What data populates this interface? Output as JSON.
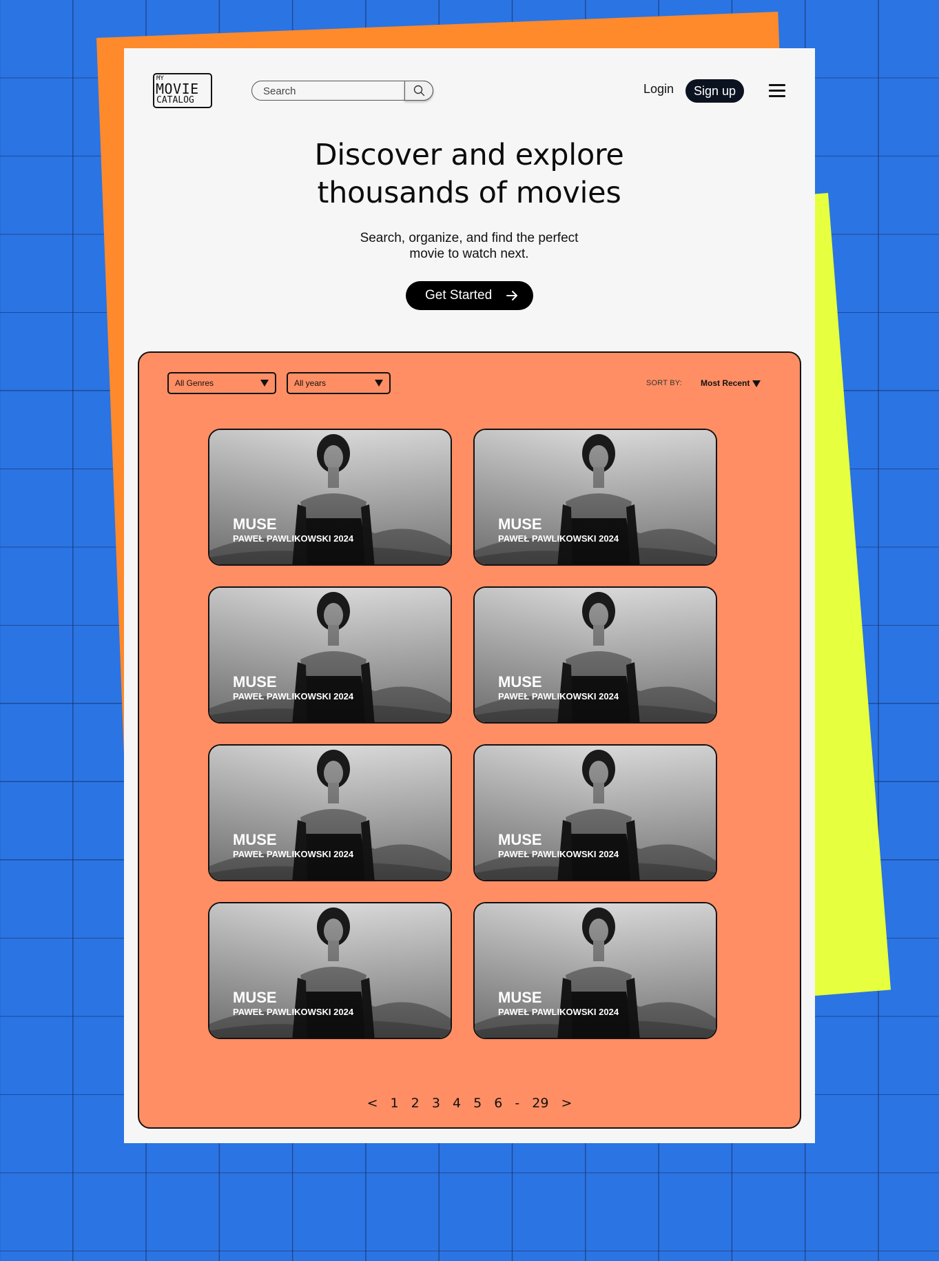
{
  "header": {
    "logo": {
      "line1": "MY",
      "line2": "MOVIE",
      "line3": "CATALOG"
    },
    "search": {
      "placeholder": "Search",
      "icon": "search-icon"
    },
    "login_label": "Login",
    "signup_label": "Sign up",
    "menu_icon": "menu-icon"
  },
  "hero": {
    "title_line1": "Discover and explore",
    "title_line2": "thousands of movies",
    "subtitle_line1": "Search, organize, and find the perfect",
    "subtitle_line2": "movie to watch next.",
    "cta_label": "Get Started",
    "cta_icon": "arrow-right-icon"
  },
  "filters": {
    "genre_selected": "All Genres",
    "year_selected": "All years",
    "sort_label": "SORT BY:",
    "sort_selected": "Most Recent"
  },
  "movies": [
    {
      "title": "MUSE",
      "meta": "PAWEŁ PAWLIKOWSKI 2024"
    },
    {
      "title": "MUSE",
      "meta": "PAWEŁ PAWLIKOWSKI 2024"
    },
    {
      "title": "MUSE",
      "meta": "PAWEŁ PAWLIKOWSKI 2024"
    },
    {
      "title": "MUSE",
      "meta": "PAWEŁ PAWLIKOWSKI 2024"
    },
    {
      "title": "MUSE",
      "meta": "PAWEŁ PAWLIKOWSKI 2024"
    },
    {
      "title": "MUSE",
      "meta": "PAWEŁ PAWLIKOWSKI 2024"
    },
    {
      "title": "MUSE",
      "meta": "PAWEŁ PAWLIKOWSKI 2024"
    },
    {
      "title": "MUSE",
      "meta": "PAWEŁ PAWLIKOWSKI 2024"
    }
  ],
  "pagination": {
    "prev": "<",
    "pages": [
      "1",
      "2",
      "3",
      "4",
      "5",
      "6"
    ],
    "ellipsis": "-",
    "last": "29",
    "next": ">"
  },
  "colors": {
    "background": "#2b74e3",
    "page": "#f6f6f6",
    "panel": "#ff8e64",
    "deco_orange": "#ff8a2b",
    "deco_yellow": "#e6ff3e",
    "primary_button": "#000000"
  }
}
